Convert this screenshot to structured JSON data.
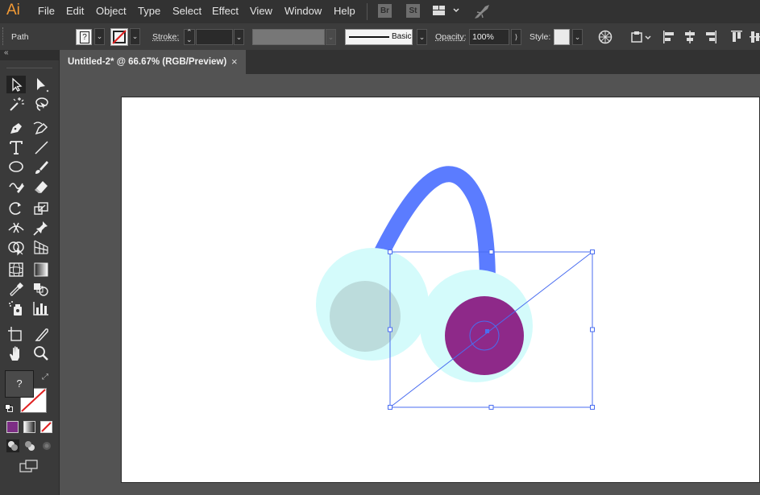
{
  "app": {
    "logo": "Ai"
  },
  "menu": {
    "items": [
      "File",
      "Edit",
      "Object",
      "Type",
      "Select",
      "Effect",
      "View",
      "Window",
      "Help"
    ],
    "bridge_label": "Br",
    "stock_label": "St"
  },
  "control_bar": {
    "selection_type": "Path",
    "fill_value": "?",
    "stroke_label": "Stroke:",
    "brush_name": "Basic",
    "opacity_label": "Opacity:",
    "opacity_value": "100%",
    "style_label": "Style:"
  },
  "document": {
    "tab_title": "Untitled-2* @ 66.67% (RGB/Preview)",
    "close_glyph": "×"
  },
  "toolbox": {
    "fill_value": "?",
    "fill_color": "#7d2e85"
  },
  "colors": {
    "headband": "#5b7cff",
    "ear_pad_light": "#d4fbfb",
    "left_cup_inner": "#bcdcdc",
    "right_cup_inner": "#8e2989",
    "selection": "#4a6df0",
    "accent": "#f29a35"
  }
}
